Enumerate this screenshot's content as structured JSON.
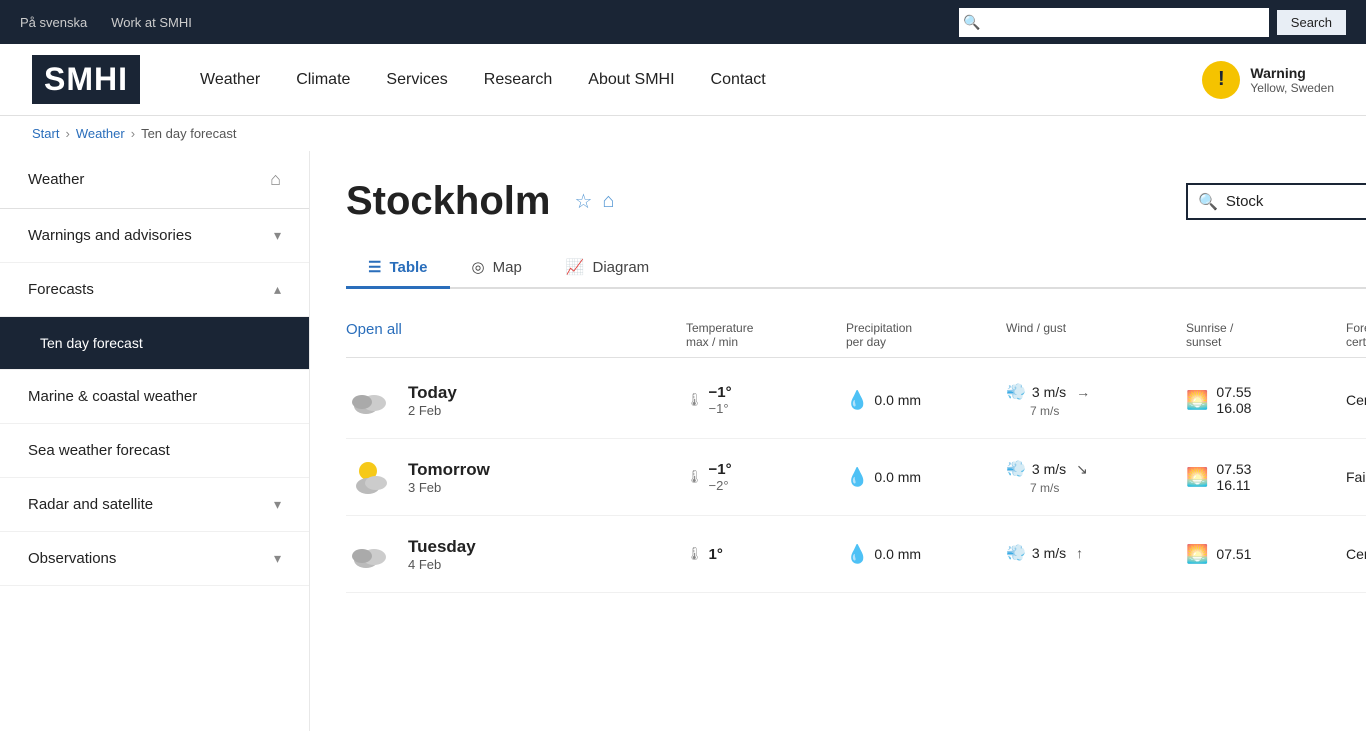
{
  "topbar": {
    "link1": "På svenska",
    "link2": "Work at SMHI",
    "search_placeholder": "",
    "search_btn": "Search"
  },
  "header": {
    "logo": "SMHI",
    "nav": [
      "Weather",
      "Climate",
      "Services",
      "Research",
      "About SMHI",
      "Contact"
    ],
    "warning": {
      "label": "Warning",
      "sublabel": "Yellow, Sweden"
    }
  },
  "breadcrumb": {
    "start": "Start",
    "weather": "Weather",
    "current": "Ten day forecast"
  },
  "sidebar": {
    "items": [
      {
        "label": "Weather",
        "hasIcon": true,
        "chevron": false,
        "active": false
      },
      {
        "label": "Warnings and advisories",
        "hasIcon": false,
        "chevron": "down",
        "active": false
      },
      {
        "label": "Forecasts",
        "hasIcon": false,
        "chevron": "up",
        "active": false
      },
      {
        "label": "Ten day forecast",
        "hasIcon": false,
        "chevron": false,
        "active": true,
        "sub": true
      },
      {
        "label": "Marine & coastal weather",
        "hasIcon": false,
        "chevron": false,
        "active": false
      },
      {
        "label": "Sea weather forecast",
        "hasIcon": false,
        "chevron": false,
        "active": false
      },
      {
        "label": "Radar and satellite",
        "hasIcon": false,
        "chevron": "down",
        "active": false
      },
      {
        "label": "Observations",
        "hasIcon": false,
        "chevron": "down",
        "active": false
      }
    ]
  },
  "city": {
    "name": "Stockholm",
    "search_value": "Stock"
  },
  "tabs": [
    {
      "label": "Table",
      "active": true
    },
    {
      "label": "Map",
      "active": false
    },
    {
      "label": "Diagram",
      "active": false
    }
  ],
  "forecast_columns": [
    {
      "line1": "",
      "line2": ""
    },
    {
      "line1": "Temperature",
      "line2": "max / min"
    },
    {
      "line1": "Precipitation",
      "line2": "per day"
    },
    {
      "line1": "Wind / gust",
      "line2": ""
    },
    {
      "line1": "Sunrise /",
      "line2": "sunset"
    },
    {
      "line1": "Forecast",
      "line2": "certainty"
    }
  ],
  "open_all": "Open all",
  "forecast_rows": [
    {
      "day": "Today",
      "date": "2 Feb",
      "icon": "cloudy",
      "temp_max": "−1°",
      "temp_min": "−1°",
      "precip": "0.0 mm",
      "wind": "3 m/s",
      "gust": "7 m/s",
      "wind_dir": "→",
      "sunrise": "07.55",
      "sunset": "16.08",
      "certainty": "Certain"
    },
    {
      "day": "Tomorrow",
      "date": "3 Feb",
      "icon": "partly-cloudy",
      "temp_max": "−1°",
      "temp_min": "−2°",
      "precip": "0.0 mm",
      "wind": "3 m/s",
      "gust": "7 m/s",
      "wind_dir": "↘",
      "sunrise": "07.53",
      "sunset": "16.11",
      "certainty": "Fairly Certain"
    },
    {
      "day": "Tuesday",
      "date": "4 Feb",
      "icon": "cloudy",
      "temp_max": "1°",
      "temp_min": "",
      "precip": "0.0 mm",
      "wind": "3 m/s",
      "gust": "",
      "wind_dir": "↑",
      "sunrise": "07.51",
      "sunset": "",
      "certainty": "Certain"
    }
  ]
}
